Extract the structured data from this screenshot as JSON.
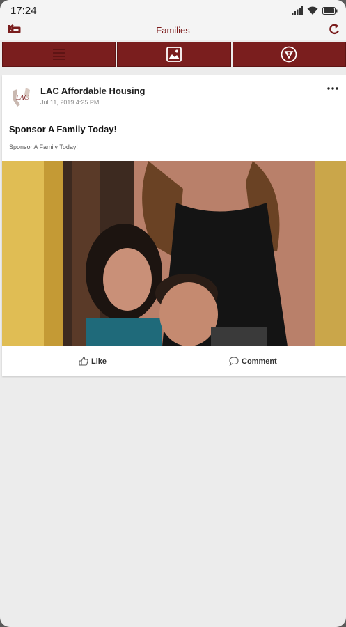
{
  "status_bar": {
    "time": "17:24",
    "icons": [
      "signal-icon",
      "wifi-icon",
      "battery-icon"
    ]
  },
  "app_bar": {
    "title": "Families",
    "back_icon": "back-arrow-icon",
    "refresh_icon": "refresh-icon"
  },
  "tabs": [
    {
      "icon": "list-icon",
      "active": true
    },
    {
      "icon": "image-icon",
      "active": false
    },
    {
      "icon": "video-icon",
      "active": false
    }
  ],
  "post": {
    "avatar_text": "LAC",
    "author": "LAC Affordable Housing",
    "date": "Jul 11, 2019 4:25 PM",
    "title": "Sponsor A Family Today!",
    "body": "Sponsor A Family Today!",
    "like_label": "Like",
    "comment_label": "Comment"
  },
  "colors": {
    "brand": "#7a1e1e",
    "title_text": "#7d1d1d",
    "background": "#ececec"
  }
}
